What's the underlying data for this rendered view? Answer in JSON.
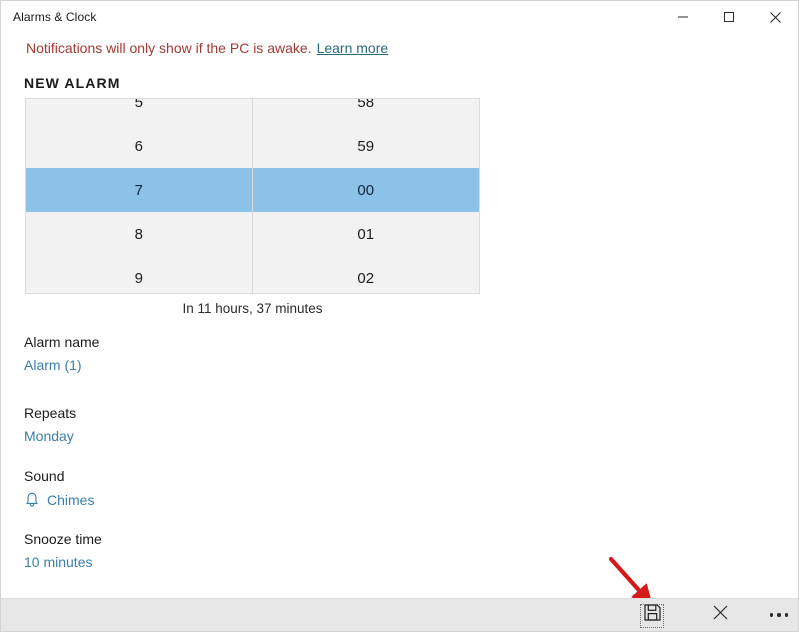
{
  "window": {
    "title": "Alarms & Clock",
    "controls": [
      {
        "name": "minimize",
        "glyph": "minimize-icon"
      },
      {
        "name": "maximize",
        "glyph": "maximize-icon"
      },
      {
        "name": "close",
        "glyph": "close-icon"
      }
    ]
  },
  "notification": {
    "message": "Notifications will only show if the PC is awake.",
    "link_label": "Learn more",
    "text_color": "#a23a33",
    "link_color": "#2a6b77"
  },
  "section": {
    "header": "NEW ALARM"
  },
  "time_picker": {
    "hours": [
      "5",
      "6",
      "7",
      "8",
      "9"
    ],
    "minutes": [
      "58",
      "59",
      "00",
      "01",
      "02"
    ],
    "selected_hour": "7",
    "selected_minute": "00",
    "selected_index": 2,
    "highlight_color": "#8cc2e8",
    "background_color": "#f2f2f2",
    "caption": "In 11 hours, 37 minutes"
  },
  "fields": {
    "alarm_name": {
      "label": "Alarm name",
      "value": "Alarm (1)"
    },
    "repeats": {
      "label": "Repeats",
      "value": "Monday"
    },
    "sound": {
      "label": "Sound",
      "value": "Chimes",
      "icon": "bell-icon"
    },
    "snooze_time": {
      "label": "Snooze time",
      "value": "10 minutes"
    }
  },
  "command_bar": {
    "background_color": "#e6e6e6",
    "buttons": [
      {
        "name": "save",
        "icon": "save-icon",
        "focused": true
      },
      {
        "name": "cancel",
        "icon": "close-icon"
      },
      {
        "name": "more",
        "icon": "more-dots-icon"
      }
    ]
  },
  "annotation": {
    "type": "arrow",
    "color": "#d41a1a",
    "points_to": "save-button"
  }
}
